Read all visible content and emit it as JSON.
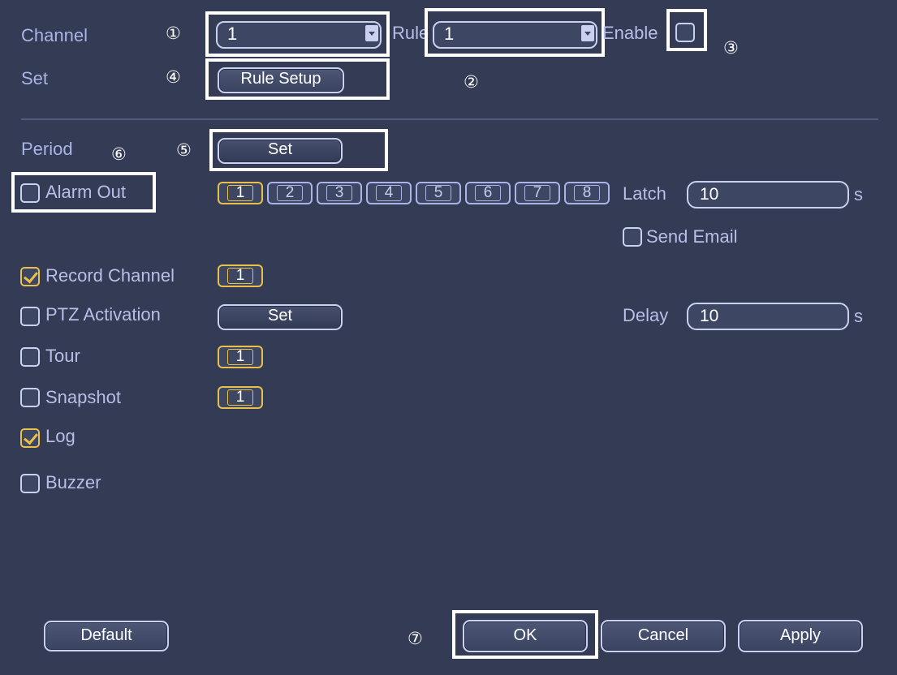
{
  "labels": {
    "channel": "Channel",
    "set": "Set",
    "rule": "Rule",
    "enable": "Enable",
    "period": "Period",
    "latch": "Latch",
    "latch_unit": "s",
    "delay": "Delay",
    "delay_unit": "s"
  },
  "callouts": [
    "①",
    "②",
    "③",
    "④",
    "⑤",
    "⑥",
    "⑦"
  ],
  "channel_select": {
    "value": "1"
  },
  "rule_select": {
    "value": "1"
  },
  "enable": {
    "checked": false
  },
  "buttons": {
    "rule_setup": "Rule Setup",
    "period_set": "Set",
    "ptz_set": "Set",
    "default": "Default",
    "ok": "OK",
    "cancel": "Cancel",
    "apply": "Apply"
  },
  "alarm_out": {
    "label": "Alarm Out",
    "checked": false,
    "channels": [
      "1",
      "2",
      "3",
      "4",
      "5",
      "6",
      "7",
      "8"
    ],
    "selected": [
      "1"
    ]
  },
  "latch_value": "10",
  "send_email": {
    "label": "Send Email",
    "checked": false
  },
  "record_channel": {
    "label": "Record Channel",
    "checked": true,
    "channel": "1"
  },
  "ptz_activation": {
    "label": "PTZ Activation",
    "checked": false
  },
  "delay_value": "10",
  "tour": {
    "label": "Tour",
    "checked": false,
    "channel": "1"
  },
  "snapshot": {
    "label": "Snapshot",
    "checked": false,
    "channel": "1"
  },
  "log": {
    "label": "Log",
    "checked": true
  },
  "buzzer": {
    "label": "Buzzer",
    "checked": false
  },
  "colors": {
    "background": "#343b55",
    "label": "#aab4e6",
    "accent_selected": "#e9c14a",
    "highlight_box": "#ffffff"
  }
}
